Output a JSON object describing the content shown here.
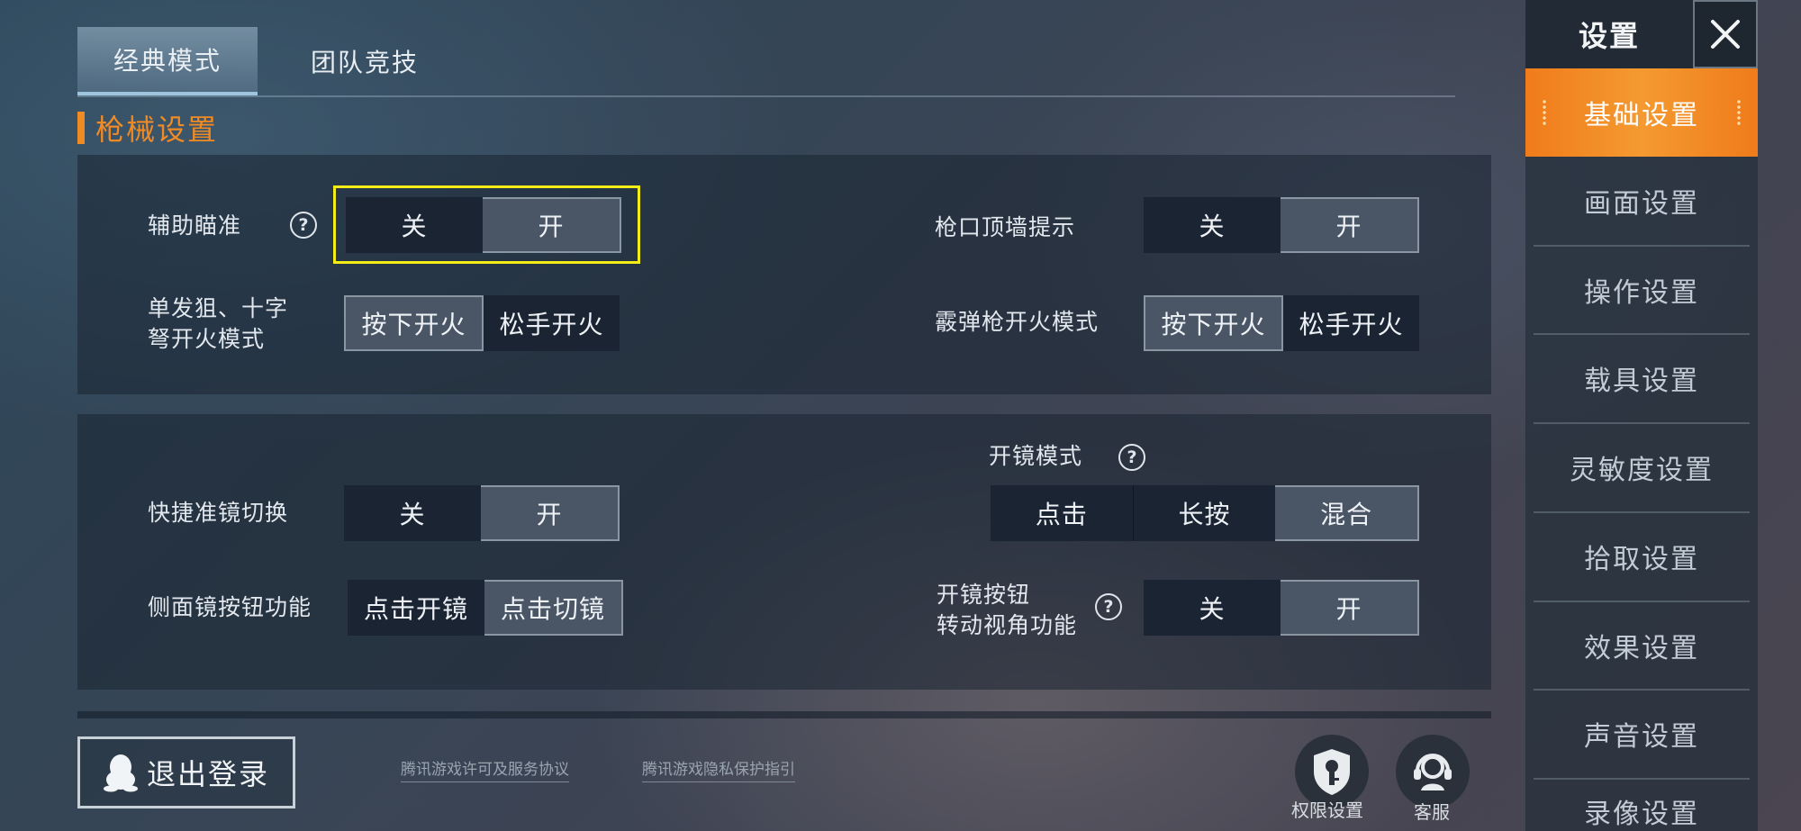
{
  "tabs": [
    {
      "label": "经典模式",
      "active": true
    },
    {
      "label": "团队竞技",
      "active": false
    }
  ],
  "section_title": "枪械设置",
  "panel1": {
    "aim_assist": {
      "label": "辅助瞄准",
      "help": "?",
      "options": [
        "关",
        "开"
      ],
      "selected": 1
    },
    "muzzle_wall": {
      "label": "枪口顶墙提示",
      "options": [
        "关",
        "开"
      ],
      "selected": 1
    },
    "sniper_fire": {
      "label_line1": "单发狙、十字",
      "label_line2": "弩开火模式",
      "options": [
        "按下开火",
        "松手开火"
      ],
      "selected": 0
    },
    "shotgun_fire": {
      "label": "霰弹枪开火模式",
      "options": [
        "按下开火",
        "松手开火"
      ],
      "selected": 0
    }
  },
  "panel2": {
    "scope_mode": {
      "label": "开镜模式",
      "help": "?",
      "options": [
        "点击",
        "长按",
        "混合"
      ],
      "selected": 2
    },
    "quick_scope": {
      "label": "快捷准镜切换",
      "options": [
        "关",
        "开"
      ],
      "selected": 1
    },
    "side_scope": {
      "label": "侧面镜按钮功能",
      "options": [
        "点击开镜",
        "点击切镜"
      ],
      "selected": 1
    },
    "scope_rotate": {
      "label_line1": "开镜按钮",
      "label_line2": "转动视角功能",
      "help": "?",
      "options": [
        "关",
        "开"
      ],
      "selected": 1
    }
  },
  "sidebar": {
    "title": "设置",
    "close_glyph": "✕",
    "items": [
      {
        "label": "基础设置",
        "active": true
      },
      {
        "label": "画面设置"
      },
      {
        "label": "操作设置"
      },
      {
        "label": "载具设置"
      },
      {
        "label": "灵敏度设置"
      },
      {
        "label": "拾取设置"
      },
      {
        "label": "效果设置"
      },
      {
        "label": "声音设置"
      },
      {
        "label": "录像设置"
      }
    ]
  },
  "footer": {
    "logout_label": "退出登录",
    "license_link": "腾讯游戏许可及服务协议",
    "privacy_link": "腾讯游戏隐私保护指引",
    "permissions_label": "权限设置",
    "service_label": "客服"
  },
  "colors": {
    "accent": "#f08a24",
    "highlight": "#f3ec17"
  },
  "icons": {
    "qq": "qq-penguin-icon",
    "permissions": "key-shield-icon",
    "service": "headset-icon",
    "close": "close-icon",
    "help": "help-icon"
  }
}
